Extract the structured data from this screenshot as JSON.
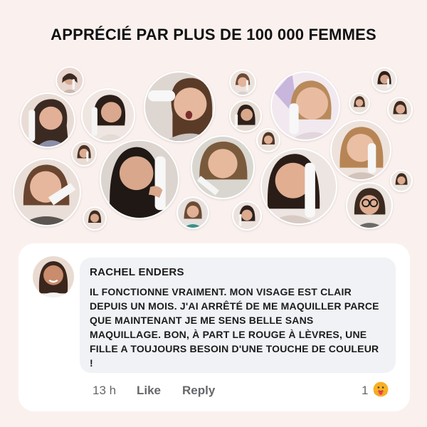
{
  "headline": "APPRÉCIÉ PAR PLUS DE 100 000 FEMMES",
  "comment": {
    "author": "RACHEL ENDERS",
    "text": "IL FONCTIONNE VRAIMENT. MON VISAGE EST CLAIR DEPUIS UN MOIS. J'AI ARRÊTÉ DE ME MAQUILLER PARCE QUE MAINTENANT JE ME SENS BELLE SANS MAQUILLAGE. BON, À PART LE ROUGE À LÈVRES, UNE FILLE A TOUJOURS BESOIN D'UNE TOUCHE DE COULEUR !",
    "time": "13 h",
    "like_label": "Like",
    "reply_label": "Reply",
    "reaction_count": "1",
    "reaction_icon": "care-reaction-icon"
  },
  "colors": {
    "background": "#faf1ef",
    "card": "#ffffff",
    "comment_bubble": "#f0f2f5",
    "action_text": "#65676b",
    "reaction": "#f7b125"
  }
}
